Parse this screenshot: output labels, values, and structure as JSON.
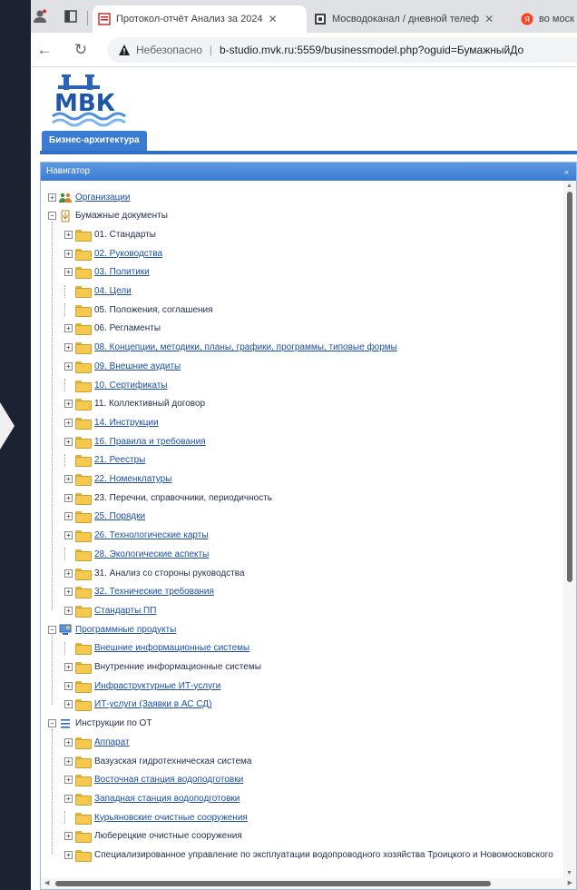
{
  "browser": {
    "tabs": [
      {
        "title": "Протокол-отчёт Анализ за 2024",
        "active": true
      },
      {
        "title": "Мосводоканал / дневной телеф",
        "active": false
      },
      {
        "title": "во моск",
        "active": false
      }
    ],
    "address": {
      "insecure_label": "Небезопасно",
      "url": "b-studio.mvk.ru:5559/businessmodel.php?oguid=БумажныйДо"
    }
  },
  "page": {
    "logo_text": "МВК",
    "top_tab": "Бизнес-архитектура",
    "navigator_title": "Навигатор",
    "collapse_glyph": "«"
  },
  "tree": {
    "roots": [
      {
        "label": "Организации",
        "link": true,
        "icon": "organizations-icon",
        "expanded": false
      },
      {
        "label": "Бумажные документы",
        "link": false,
        "icon": "documents-icon",
        "expanded": true,
        "children": [
          {
            "label": "01. Стандарты",
            "link": false,
            "expandable": true
          },
          {
            "label": "02. Руководства",
            "link": true,
            "expandable": true
          },
          {
            "label": "03. Политики",
            "link": true,
            "expandable": true
          },
          {
            "label": "04. Цели",
            "link": true,
            "expandable": false
          },
          {
            "label": "05. Положения, соглашения",
            "link": false,
            "expandable": false
          },
          {
            "label": "06. Регламенты",
            "link": false,
            "expandable": true
          },
          {
            "label": "08. Концепции, методики, планы, графики, программы, типовые формы",
            "link": true,
            "expandable": true
          },
          {
            "label": "09. Внешние аудиты",
            "link": true,
            "expandable": true
          },
          {
            "label": "10. Сертификаты",
            "link": true,
            "expandable": false
          },
          {
            "label": "11. Коллективный договор",
            "link": false,
            "expandable": true
          },
          {
            "label": "14. Инструкции",
            "link": true,
            "expandable": true
          },
          {
            "label": "16. Правила и требования",
            "link": true,
            "expandable": true
          },
          {
            "label": "21. Реестры",
            "link": true,
            "expandable": false
          },
          {
            "label": "22. Номенклатуры",
            "link": true,
            "expandable": true
          },
          {
            "label": "23. Перечни, справочники, периодичность",
            "link": false,
            "expandable": true
          },
          {
            "label": "25. Порядки",
            "link": true,
            "expandable": true
          },
          {
            "label": "26. Технологические карты",
            "link": true,
            "expandable": true
          },
          {
            "label": "28. Экологические аспекты",
            "link": true,
            "expandable": false
          },
          {
            "label": "31. Анализ со стороны руководства",
            "link": false,
            "expandable": true
          },
          {
            "label": "32. Технические требования",
            "link": true,
            "expandable": true
          },
          {
            "label": "Стандарты ПП",
            "link": true,
            "expandable": true
          }
        ]
      },
      {
        "label": "Программные продукты",
        "link": true,
        "icon": "software-icon",
        "expanded": true,
        "children": [
          {
            "label": "Внешние информационные системы",
            "link": true,
            "expandable": false
          },
          {
            "label": "Внутренние информационные системы",
            "link": false,
            "expandable": true
          },
          {
            "label": "Инфраструктурные ИТ-услуги",
            "link": true,
            "expandable": true
          },
          {
            "label": "ИТ-услуги (Заявки в АС СД)",
            "link": true,
            "expandable": true
          }
        ]
      },
      {
        "label": "Инструкции по ОТ",
        "link": false,
        "icon": "instructions-icon",
        "expanded": true,
        "children": [
          {
            "label": "Аппарат",
            "link": true,
            "expandable": true
          },
          {
            "label": "Вазузская гидротехническая система",
            "link": false,
            "expandable": true
          },
          {
            "label": "Восточная станция водоподготовки",
            "link": true,
            "expandable": true
          },
          {
            "label": "Западная станция водоподготовки",
            "link": true,
            "expandable": true
          },
          {
            "label": "Курьяновские очистные сооружения",
            "link": true,
            "expandable": false
          },
          {
            "label": "Люберецкие очистные сооружения",
            "link": false,
            "expandable": true
          },
          {
            "label": "Специализированное управление по эксплуатации водопроводного хозяйства Троицкого и Новомосковского",
            "link": false,
            "expandable": true
          }
        ]
      }
    ]
  },
  "colors": {
    "accent": "#3b7cd3",
    "link": "#1a4ea8",
    "folder": "#f4c94e"
  }
}
